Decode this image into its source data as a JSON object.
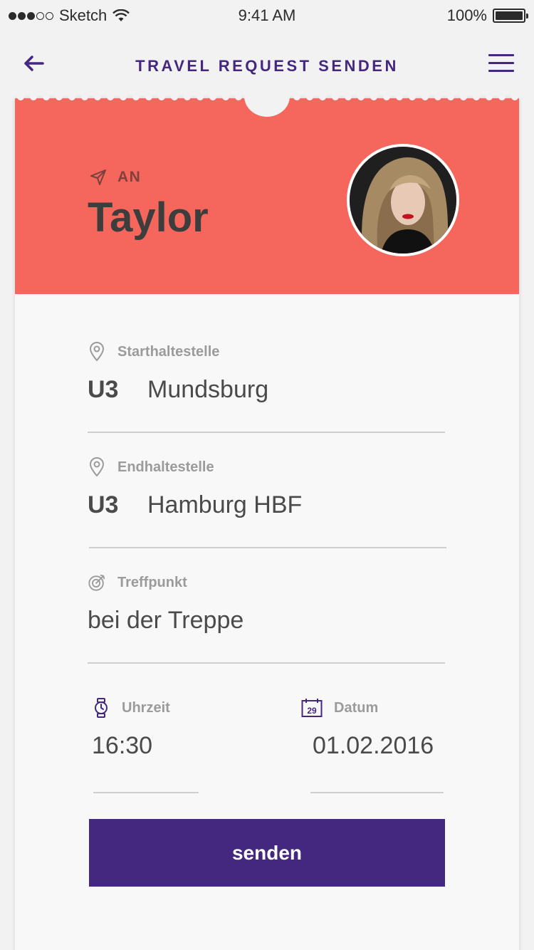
{
  "status_bar": {
    "carrier": "Sketch",
    "time": "9:41 AM",
    "battery": "100%"
  },
  "nav": {
    "title": "TRAVEL REQUEST SENDEN"
  },
  "recipient": {
    "to_label": "AN",
    "name": "Taylor"
  },
  "form": {
    "start": {
      "label": "Starthaltestelle",
      "line": "U3",
      "station": "Mundsburg"
    },
    "end": {
      "label": "Endhaltestelle",
      "line": "U3",
      "station": "Hamburg HBF"
    },
    "meeting_point": {
      "label": "Treffpunkt",
      "value": "bei der Treppe"
    },
    "time": {
      "label": "Uhrzeit",
      "value": "16:30"
    },
    "date": {
      "label": "Datum",
      "value": "01.02.2016",
      "icon_day": "29"
    }
  },
  "submit_label": "senden",
  "colors": {
    "accent": "#44277f",
    "header": "#f5675d",
    "background": "#f2f2f2",
    "card": "#f8f8f8"
  },
  "icons": [
    "back-arrow-icon",
    "menu-icon",
    "send-icon",
    "location-pin-icon",
    "target-icon",
    "watch-icon",
    "calendar-icon",
    "wifi-icon",
    "battery-icon"
  ]
}
